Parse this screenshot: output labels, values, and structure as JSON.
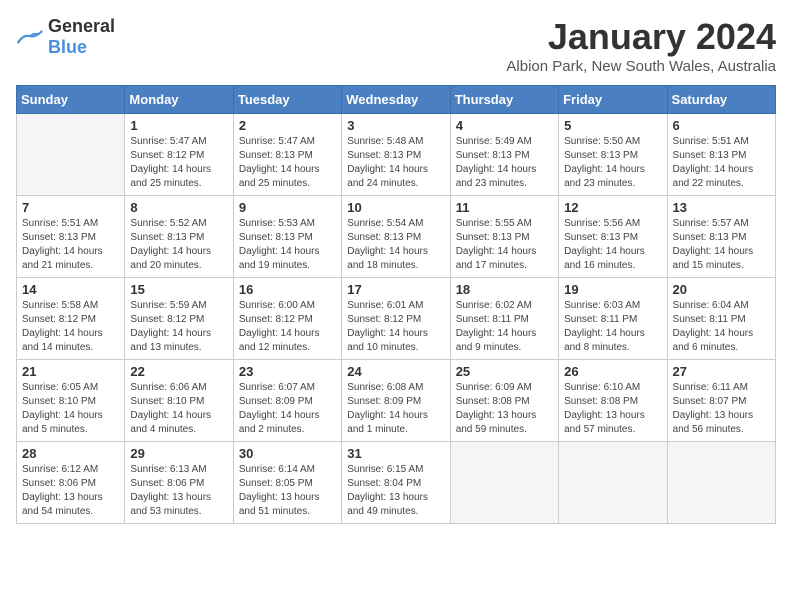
{
  "logo": {
    "general": "General",
    "blue": "Blue"
  },
  "title": "January 2024",
  "location": "Albion Park, New South Wales, Australia",
  "days_of_week": [
    "Sunday",
    "Monday",
    "Tuesday",
    "Wednesday",
    "Thursday",
    "Friday",
    "Saturday"
  ],
  "weeks": [
    [
      {
        "day": "",
        "info": ""
      },
      {
        "day": "1",
        "info": "Sunrise: 5:47 AM\nSunset: 8:12 PM\nDaylight: 14 hours\nand 25 minutes."
      },
      {
        "day": "2",
        "info": "Sunrise: 5:47 AM\nSunset: 8:13 PM\nDaylight: 14 hours\nand 25 minutes."
      },
      {
        "day": "3",
        "info": "Sunrise: 5:48 AM\nSunset: 8:13 PM\nDaylight: 14 hours\nand 24 minutes."
      },
      {
        "day": "4",
        "info": "Sunrise: 5:49 AM\nSunset: 8:13 PM\nDaylight: 14 hours\nand 23 minutes."
      },
      {
        "day": "5",
        "info": "Sunrise: 5:50 AM\nSunset: 8:13 PM\nDaylight: 14 hours\nand 23 minutes."
      },
      {
        "day": "6",
        "info": "Sunrise: 5:51 AM\nSunset: 8:13 PM\nDaylight: 14 hours\nand 22 minutes."
      }
    ],
    [
      {
        "day": "7",
        "info": "Sunrise: 5:51 AM\nSunset: 8:13 PM\nDaylight: 14 hours\nand 21 minutes."
      },
      {
        "day": "8",
        "info": "Sunrise: 5:52 AM\nSunset: 8:13 PM\nDaylight: 14 hours\nand 20 minutes."
      },
      {
        "day": "9",
        "info": "Sunrise: 5:53 AM\nSunset: 8:13 PM\nDaylight: 14 hours\nand 19 minutes."
      },
      {
        "day": "10",
        "info": "Sunrise: 5:54 AM\nSunset: 8:13 PM\nDaylight: 14 hours\nand 18 minutes."
      },
      {
        "day": "11",
        "info": "Sunrise: 5:55 AM\nSunset: 8:13 PM\nDaylight: 14 hours\nand 17 minutes."
      },
      {
        "day": "12",
        "info": "Sunrise: 5:56 AM\nSunset: 8:13 PM\nDaylight: 14 hours\nand 16 minutes."
      },
      {
        "day": "13",
        "info": "Sunrise: 5:57 AM\nSunset: 8:13 PM\nDaylight: 14 hours\nand 15 minutes."
      }
    ],
    [
      {
        "day": "14",
        "info": "Sunrise: 5:58 AM\nSunset: 8:12 PM\nDaylight: 14 hours\nand 14 minutes."
      },
      {
        "day": "15",
        "info": "Sunrise: 5:59 AM\nSunset: 8:12 PM\nDaylight: 14 hours\nand 13 minutes."
      },
      {
        "day": "16",
        "info": "Sunrise: 6:00 AM\nSunset: 8:12 PM\nDaylight: 14 hours\nand 12 minutes."
      },
      {
        "day": "17",
        "info": "Sunrise: 6:01 AM\nSunset: 8:12 PM\nDaylight: 14 hours\nand 10 minutes."
      },
      {
        "day": "18",
        "info": "Sunrise: 6:02 AM\nSunset: 8:11 PM\nDaylight: 14 hours\nand 9 minutes."
      },
      {
        "day": "19",
        "info": "Sunrise: 6:03 AM\nSunset: 8:11 PM\nDaylight: 14 hours\nand 8 minutes."
      },
      {
        "day": "20",
        "info": "Sunrise: 6:04 AM\nSunset: 8:11 PM\nDaylight: 14 hours\nand 6 minutes."
      }
    ],
    [
      {
        "day": "21",
        "info": "Sunrise: 6:05 AM\nSunset: 8:10 PM\nDaylight: 14 hours\nand 5 minutes."
      },
      {
        "day": "22",
        "info": "Sunrise: 6:06 AM\nSunset: 8:10 PM\nDaylight: 14 hours\nand 4 minutes."
      },
      {
        "day": "23",
        "info": "Sunrise: 6:07 AM\nSunset: 8:09 PM\nDaylight: 14 hours\nand 2 minutes."
      },
      {
        "day": "24",
        "info": "Sunrise: 6:08 AM\nSunset: 8:09 PM\nDaylight: 14 hours\nand 1 minute."
      },
      {
        "day": "25",
        "info": "Sunrise: 6:09 AM\nSunset: 8:08 PM\nDaylight: 13 hours\nand 59 minutes."
      },
      {
        "day": "26",
        "info": "Sunrise: 6:10 AM\nSunset: 8:08 PM\nDaylight: 13 hours\nand 57 minutes."
      },
      {
        "day": "27",
        "info": "Sunrise: 6:11 AM\nSunset: 8:07 PM\nDaylight: 13 hours\nand 56 minutes."
      }
    ],
    [
      {
        "day": "28",
        "info": "Sunrise: 6:12 AM\nSunset: 8:06 PM\nDaylight: 13 hours\nand 54 minutes."
      },
      {
        "day": "29",
        "info": "Sunrise: 6:13 AM\nSunset: 8:06 PM\nDaylight: 13 hours\nand 53 minutes."
      },
      {
        "day": "30",
        "info": "Sunrise: 6:14 AM\nSunset: 8:05 PM\nDaylight: 13 hours\nand 51 minutes."
      },
      {
        "day": "31",
        "info": "Sunrise: 6:15 AM\nSunset: 8:04 PM\nDaylight: 13 hours\nand 49 minutes."
      },
      {
        "day": "",
        "info": ""
      },
      {
        "day": "",
        "info": ""
      },
      {
        "day": "",
        "info": ""
      }
    ]
  ]
}
